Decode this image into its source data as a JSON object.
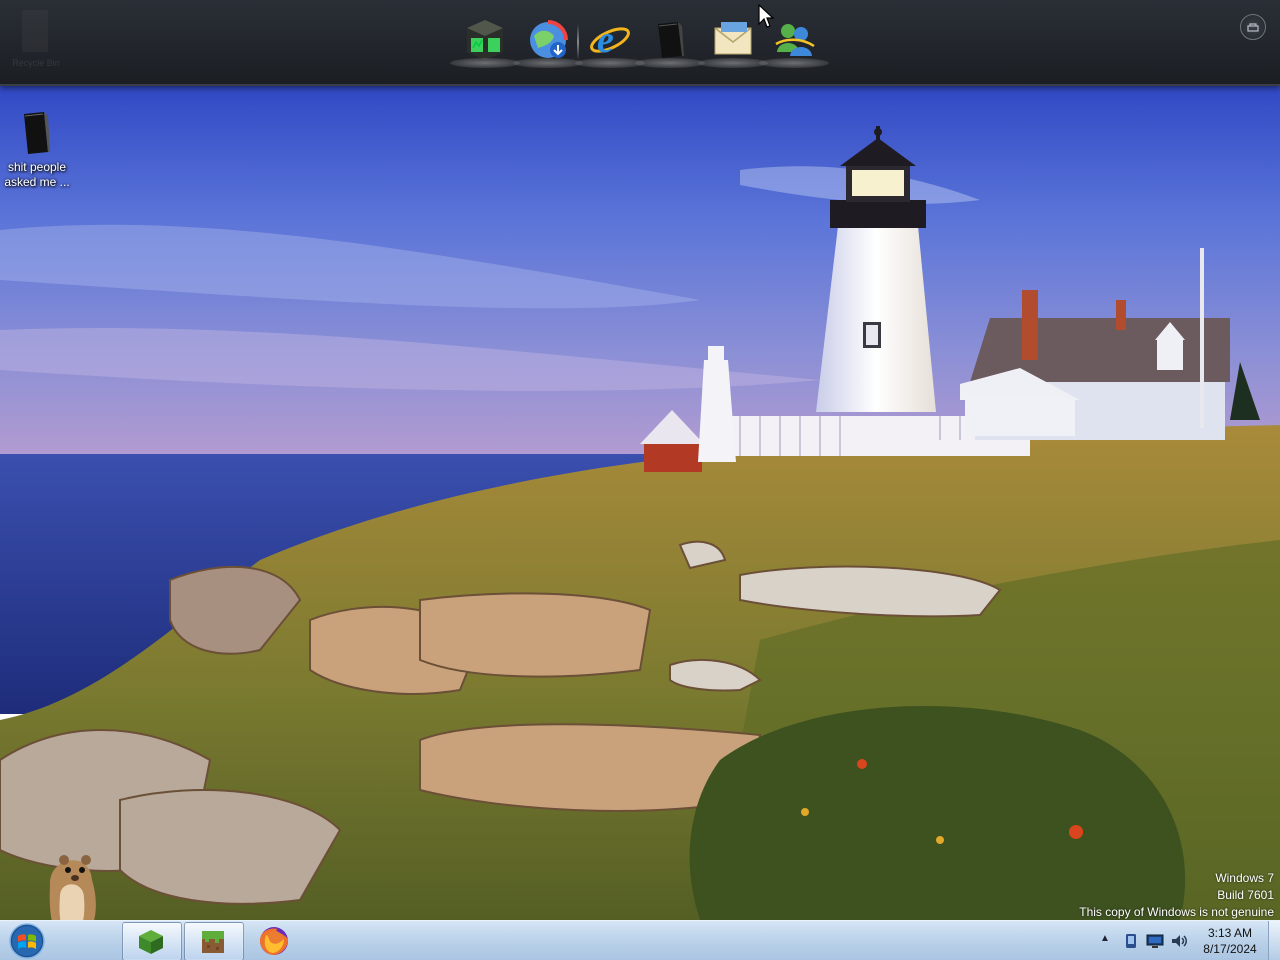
{
  "dock": {
    "items": [
      {
        "name": "Task Manager",
        "icon": "task-manager-icon"
      },
      {
        "name": "Browser Updater",
        "icon": "globe-download-icon"
      },
      {
        "name": "Internet Explorer",
        "icon": "internet-explorer-icon"
      },
      {
        "name": "Dark Box",
        "icon": "black-box-icon"
      },
      {
        "name": "Mail",
        "icon": "mail-envelope-icon"
      },
      {
        "name": "Messenger",
        "icon": "messenger-people-icon"
      }
    ],
    "left_ghost_label": "Recycle Bin"
  },
  "desktop_icons": [
    {
      "label_line1": "shit people",
      "label_line2": "asked me ...",
      "icon": "black-box-icon"
    }
  ],
  "watermark": {
    "line1": "Windows 7",
    "line2": "Build 7601",
    "line3": "This copy of Windows is not genuine"
  },
  "taskbar": {
    "start_icon": "windows-orb-icon",
    "pinned": [
      {
        "icon": "minecraft-grass-block-icon",
        "active": true
      },
      {
        "icon": "minecraft-grass-block-icon",
        "active": true
      },
      {
        "icon": "firefox-icon",
        "active": false
      }
    ],
    "tray": {
      "chevron": "▲",
      "icons": [
        "phone-icon",
        "monitor-icon",
        "volume-icon"
      ]
    },
    "clock": {
      "time": "3:13 AM",
      "date": "8/17/2024"
    }
  },
  "colors": {
    "sky_top": "#3d55c8",
    "sea": "#2b3f9e",
    "taskbar": "#bcd3ea",
    "dock": "#22262c"
  }
}
